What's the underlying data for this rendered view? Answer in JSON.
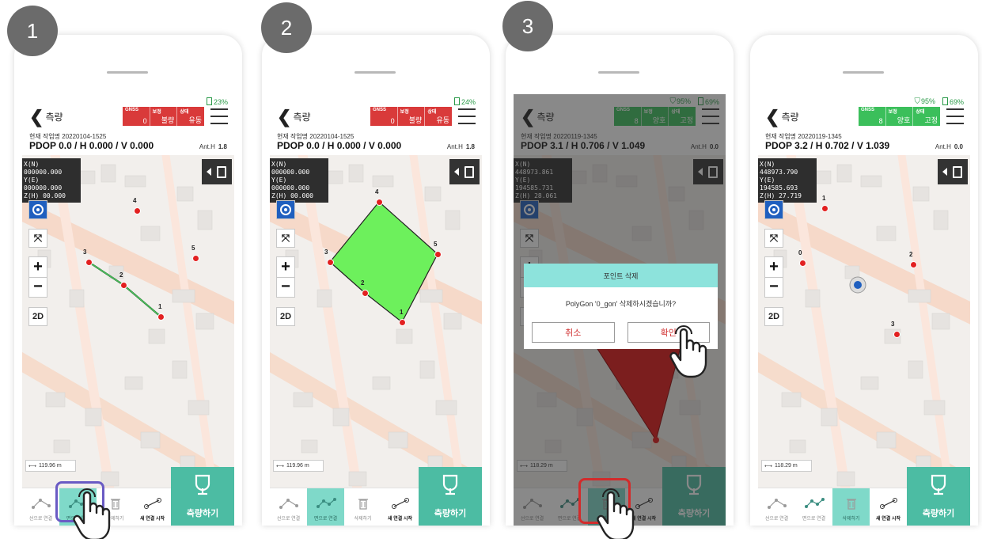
{
  "steps": [
    "1",
    "2",
    "3"
  ],
  "common": {
    "back_label": "측량",
    "gnss_labels": [
      "GNSS",
      "보정",
      "상태"
    ],
    "anth_label": "Ant.H",
    "tools": [
      "선으로 연결",
      "면으로 연결",
      "삭제하기",
      "새 연결 시작"
    ],
    "measure_label": "측량하기",
    "zoom_in": "+",
    "zoom_out": "−",
    "mode_2d": "2D"
  },
  "screens": [
    {
      "battery": "23%",
      "signal": "",
      "gnss_values": [
        "0",
        "불량",
        "유동"
      ],
      "gnss_color": "#d93a3a",
      "job": "현재 작업명 20220104-1525",
      "pdop": "PDOP 0.0 / H 0.000 / V 0.000",
      "anth_value": "1.8",
      "coords": [
        "X(N) 000000.000",
        "Y(E) 000000.000",
        "Z(H) 00.000"
      ],
      "scale": "119.96 m",
      "points": [
        "1",
        "2",
        "3",
        "4",
        "5"
      ],
      "active_tool": 1
    },
    {
      "battery": "24%",
      "signal": "",
      "gnss_values": [
        "0",
        "불량",
        "유동"
      ],
      "gnss_color": "#d93a3a",
      "job": "현재 작업명 20220104-1525",
      "pdop": "PDOP 0.0 / H 0.000 / V 0.000",
      "anth_value": "1.8",
      "coords": [
        "X(N) 000000.000",
        "Y(E) 000000.000",
        "Z(H) 00.000"
      ],
      "scale": "119.96 m",
      "points": [
        "1",
        "2",
        "3",
        "4",
        "5"
      ],
      "active_tool": 1
    },
    {
      "battery": "69%",
      "signal": "95%",
      "gnss_values": [
        "8",
        "양호",
        "고정"
      ],
      "gnss_color": "#3bbf5b",
      "job": "현재 작업명 20220119-1345",
      "pdop": "PDOP 3.1 / H 0.706 / V 1.049",
      "anth_value": "0.0",
      "coords": [
        "X(N) 448973.861",
        "Y(E) 194585.731",
        "Z(H) 28.061"
      ],
      "scale": "118.29 m",
      "points": [],
      "active_tool": 2,
      "dialog": {
        "title": "포인트 삭제",
        "message": "PolyGon '0_gon' 삭제하시겠습니까?",
        "cancel": "취소",
        "confirm": "확인"
      }
    },
    {
      "battery": "69%",
      "signal": "95%",
      "gnss_values": [
        "8",
        "양호",
        "고정"
      ],
      "gnss_color": "#3bbf5b",
      "job": "현재 작업명 20220119-1345",
      "pdop": "PDOP 3.2 / H 0.702 / V 1.039",
      "anth_value": "0.0",
      "coords": [
        "X(N) 448973.790",
        "Y(E) 194585.693",
        "Z(H) 27.719"
      ],
      "scale": "118.29 m",
      "points": [
        "0",
        "1",
        "2",
        "3"
      ],
      "active_tool": 2
    }
  ]
}
